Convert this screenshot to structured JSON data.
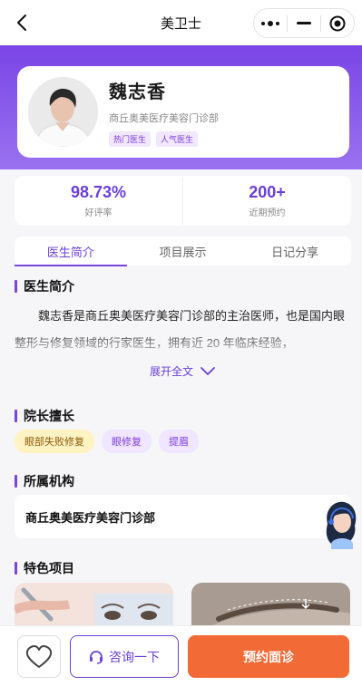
{
  "nav": {
    "title": "美卫士",
    "icons": [
      "chevron-left-icon",
      "more-dots-icon",
      "minimize-icon",
      "close-circle-icon"
    ]
  },
  "doctor": {
    "name": "魏志香",
    "clinic": "商丘奥美医疗美容门诊部",
    "tags": [
      "热门医生",
      "人气医生"
    ]
  },
  "stats": [
    {
      "value": "98.73%",
      "label": "好评率"
    },
    {
      "value": "200+",
      "label": "近期预约"
    }
  ],
  "tabs": [
    "医生简介",
    "项目展示",
    "日记分享"
  ],
  "intro": {
    "title": "医生简介",
    "text": "魏志香是商丘奥美医疗美容门诊部的主治医师，也是国内眼整形与修复领域的行家医生，拥有近 20 年临床经验，",
    "expand_label": "展开全文"
  },
  "skills": {
    "title": "院长擅长",
    "items": [
      "眼部失败修复",
      "眼修复",
      "提眉"
    ]
  },
  "institution": {
    "title": "所属机构",
    "name": "商丘奥美医疗美容门诊部"
  },
  "features": {
    "title": "特色项目"
  },
  "bottom": {
    "consult_label": "咨询一下",
    "book_label": "预约面诊"
  },
  "colors": {
    "primary": "#7a45e6",
    "accent_orange": "#f26a35",
    "tag_yellow_bg": "#fff3c4"
  }
}
